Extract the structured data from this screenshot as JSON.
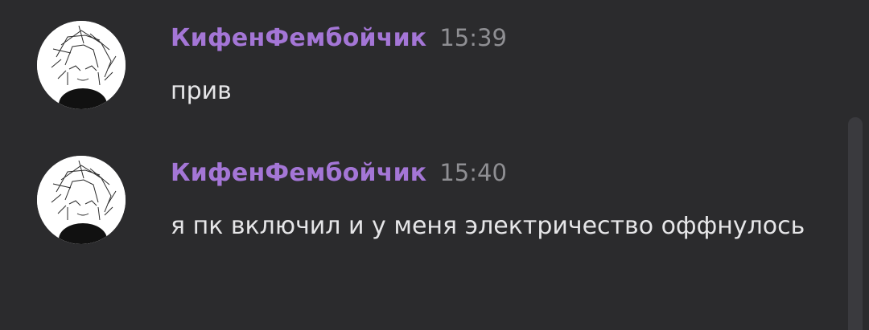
{
  "messages": [
    {
      "username": "КифенФембойчик",
      "time": "15:39",
      "text": "прив"
    },
    {
      "username": "КифенФембойчик",
      "time": "15:40",
      "text": "я пк включил и у меня электричество оффнулось"
    }
  ],
  "colors": {
    "background": "#2b2b2d",
    "username": "#a476d6",
    "timestamp": "#8f8f93",
    "text": "#e6e6e8",
    "scrollbar": "#3a3a3e"
  },
  "icons": {
    "avatar": "sketch-avatar-image"
  }
}
